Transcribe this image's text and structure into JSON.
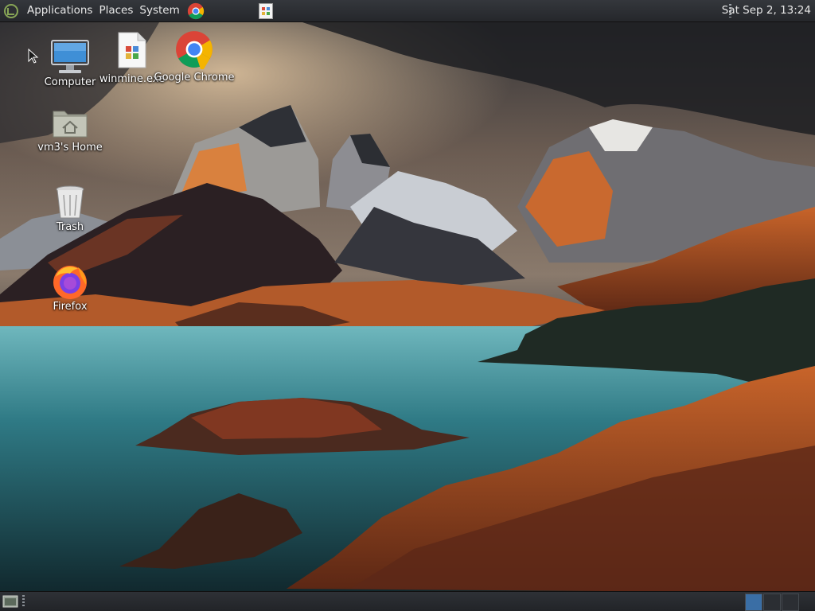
{
  "top_panel": {
    "menu": {
      "applications": "Applications",
      "places": "Places",
      "system": "System"
    },
    "launchers": [
      {
        "icon": "chrome-icon"
      }
    ],
    "tray_app_icon": "winmine-icon",
    "clock": "Sat Sep  2, 13:24"
  },
  "desktop": {
    "icons": [
      {
        "label": "Computer",
        "icon": "computer-icon"
      },
      {
        "label": "winmine.exe",
        "icon": "exe-file-icon"
      },
      {
        "label": "Google Chrome",
        "icon": "chrome-icon"
      },
      {
        "label": "vm3's Home",
        "icon": "home-folder-icon"
      },
      {
        "label": "Trash",
        "icon": "trash-icon"
      },
      {
        "label": "Firefox",
        "icon": "firefox-icon"
      }
    ]
  },
  "bottom_panel": {
    "show_desktop_icon": "show-desktop-icon",
    "workspaces": 3
  },
  "colors": {
    "panel_bg": "#2b2e33",
    "panel_text": "#e8e8e8",
    "chrome_red": "#db4437",
    "chrome_yellow": "#f4b400",
    "chrome_green": "#0f9d58",
    "chrome_blue": "#4285f4"
  }
}
